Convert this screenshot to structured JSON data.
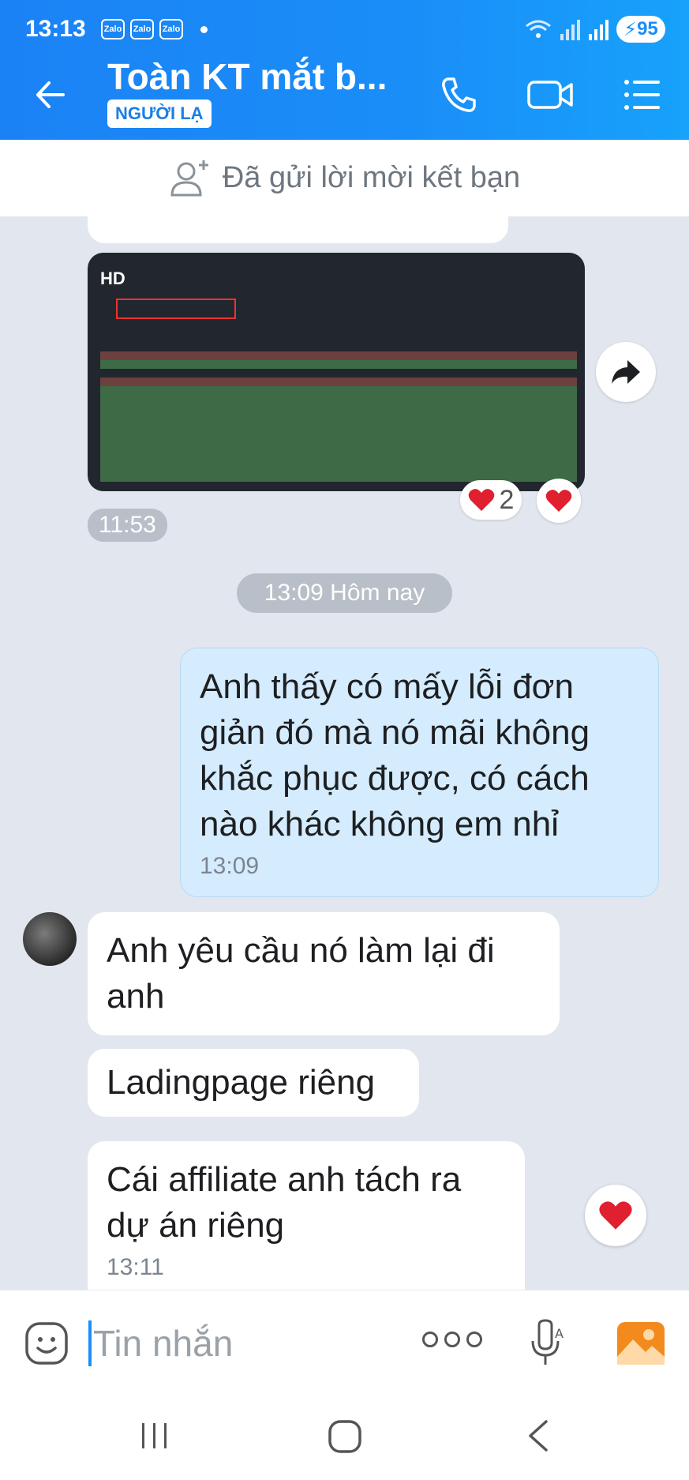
{
  "status_bar": {
    "time": "13:13",
    "notification_badges": [
      "Zalo",
      "Zalo",
      "Zalo"
    ],
    "battery": "95"
  },
  "header": {
    "title": "Toàn KT mắt b...",
    "badge": "NGƯỜI LẠ",
    "icons": [
      "back-arrow-icon",
      "phone-icon",
      "video-call-icon",
      "menu-icon"
    ]
  },
  "friend_banner": {
    "text": "Đã gửi lời mời kết bạn"
  },
  "messages": {
    "image_message": {
      "quality_badge": "HD",
      "reaction_count": "2",
      "time": "11:53"
    },
    "date_separator": "13:09 Hôm nay",
    "outgoing": {
      "text": "Anh thấy có mấy lỗi đơn giản đó mà nó mãi không khắc phục được, có cách nào khác không em nhỉ",
      "time": "13:09"
    },
    "incoming": [
      {
        "text": "Anh yêu cầu nó làm lại đi anh"
      },
      {
        "text": "Ladingpage riêng"
      },
      {
        "text": "Cái affiliate anh tách ra dự án riêng",
        "time": "13:11"
      }
    ]
  },
  "input": {
    "placeholder": "Tin nhắn"
  },
  "colors": {
    "header_blue": "#1a8ef8",
    "outgoing_bubble": "#d4ecfd",
    "heart": "#e0202e"
  }
}
